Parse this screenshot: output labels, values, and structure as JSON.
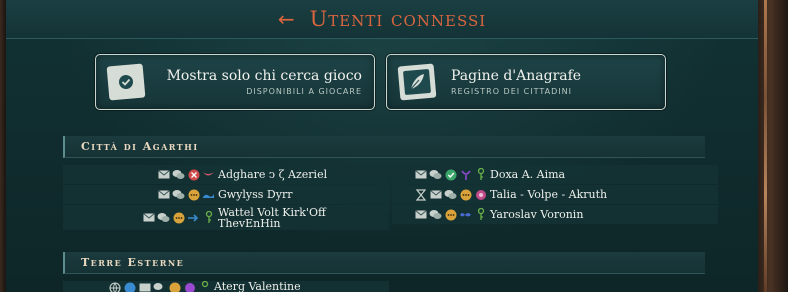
{
  "header": {
    "title": "Utenti connessi"
  },
  "buttons": [
    {
      "label": "Mostra solo chi cerca gioco",
      "sub": "DISPONIBILI A GIOCARE"
    },
    {
      "label": "Pagine d'Anagrafe",
      "sub": "REGISTRO DEI CITTADINI"
    }
  ],
  "sections": [
    {
      "title": "Città di Agarthi"
    },
    {
      "title": "Terre Esterne"
    }
  ],
  "users_left": [
    {
      "name": "Adghare ↄ ζ Azeriel"
    },
    {
      "name": "Gwylyss Dyrr"
    },
    {
      "name": "Wattel Volt Kirk'Off\nThevEnHin"
    }
  ],
  "users_right": [
    {
      "name": "Doxa A. Aima"
    },
    {
      "name": "Talia - Volpe - Akruth"
    },
    {
      "name": "Yaroslav Voronin"
    }
  ],
  "users_outer": [
    {
      "name": "Aterg Valentine"
    }
  ],
  "colors": {
    "accent": "#d9653e",
    "background": "#0f2a2c",
    "status_busy": "#d04a4a",
    "status_free": "#3aa66a",
    "status_chat": "#d9a23a"
  }
}
